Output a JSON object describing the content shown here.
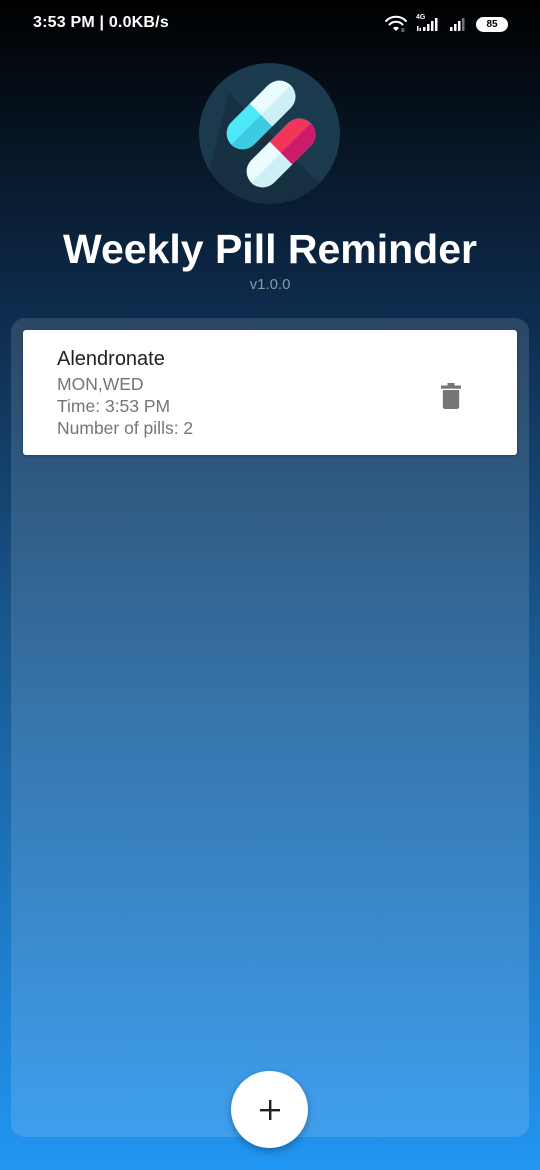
{
  "status_bar": {
    "time_network": "3:53 PM | 0.0KB/s",
    "network_type": "4G",
    "battery_level": "85",
    "icons": [
      "wifi-icon",
      "signal-icon",
      "signal-icon",
      "battery-icon"
    ]
  },
  "header": {
    "logo_icon": "pills-icon",
    "title": "Weekly Pill Reminder",
    "version": "v1.0.0"
  },
  "reminders": [
    {
      "name": "Alendronate",
      "days": "MON,WED",
      "time": "Time: 3:53 PM",
      "pills": "Number of pills: 2",
      "action_icon": "trash-icon"
    }
  ],
  "fab": {
    "icon": "plus-icon",
    "label": "+"
  },
  "colors": {
    "gradient_top": "#000000",
    "gradient_bottom": "#2196f3",
    "card_bg": "#ffffff",
    "pill_cyan": "#4de8f5",
    "pill_red": "#f2365a",
    "logo_bg": "#1b3a4e"
  }
}
